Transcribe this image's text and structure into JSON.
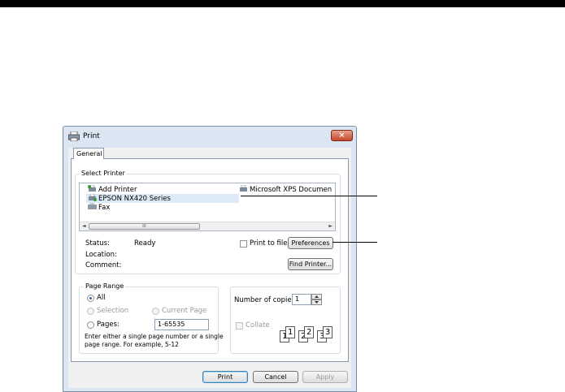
{
  "dialog": {
    "title": "Print",
    "close_glyph": "×",
    "tab": "General"
  },
  "select_printer": {
    "label": "Select Printer",
    "printers": [
      {
        "name": "Add Printer",
        "icon": "add-printer-icon"
      },
      {
        "name": "Microsoft XPS Documen",
        "icon": "printer-icon"
      },
      {
        "name": "EPSON NX420 Series",
        "icon": "printer-icon",
        "selected": true
      },
      {
        "name": "Fax",
        "icon": "fax-icon"
      }
    ],
    "scroll_left": "◄",
    "scroll_right": "►",
    "scroll_thumb": "III",
    "status_label": "Status:",
    "status_value": "Ready",
    "location_label": "Location:",
    "comment_label": "Comment:",
    "print_to_file": "Print to file",
    "preferences_button": "Preferences",
    "find_printer_button": "Find Printer..."
  },
  "page_range": {
    "label": "Page Range",
    "all": "All",
    "selection": "Selection",
    "current_page": "Current Page",
    "pages": "Pages:",
    "pages_value": "1-65535",
    "hint_line1": "Enter either a single page number or a single",
    "hint_line2": "page range.  For example, 5-12"
  },
  "copies": {
    "label": "Number of copies:",
    "value": "1",
    "collate": "Collate",
    "collate_icons": [
      "1",
      "1",
      "2",
      "2",
      "3",
      "3"
    ]
  },
  "footer": {
    "print": "Print",
    "cancel": "Cancel",
    "apply": "Apply"
  },
  "colors": {
    "selected_row": "#dceaf8",
    "close_button": "#c7462c",
    "frame": "#dbe6f2"
  }
}
